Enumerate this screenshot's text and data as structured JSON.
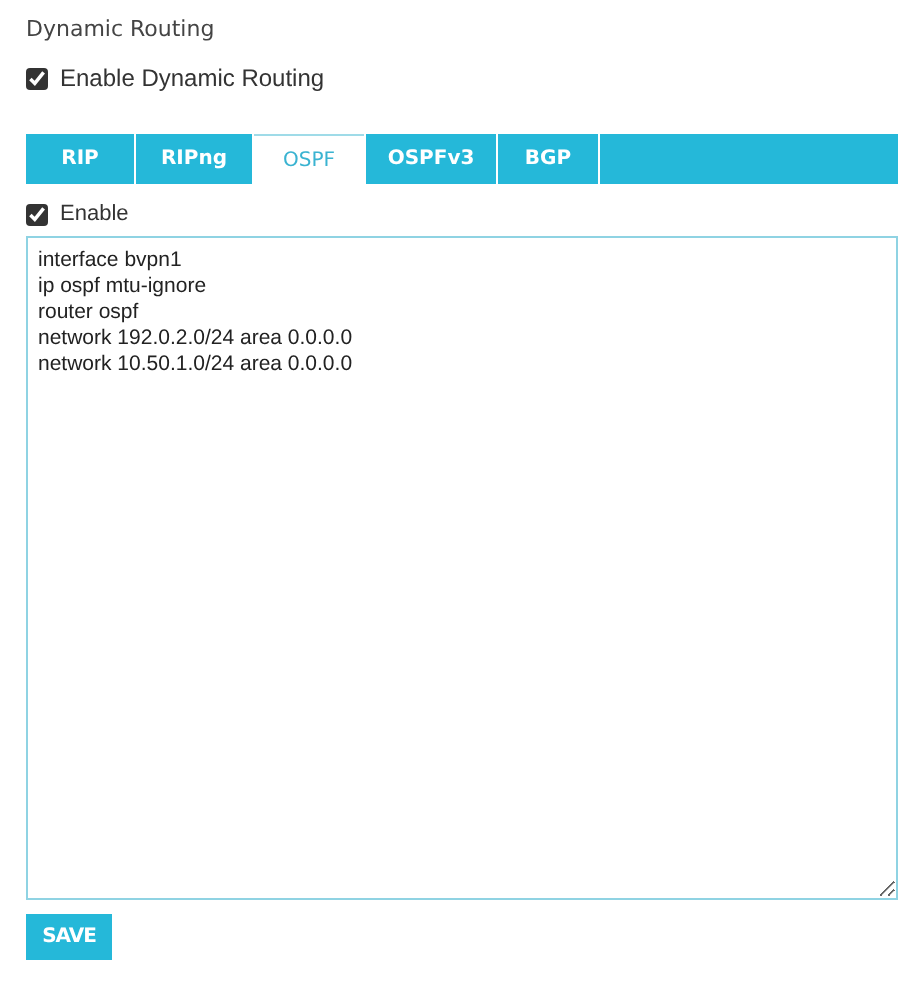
{
  "section_title": "Dynamic Routing",
  "enable_dynamic_routing": {
    "label": "Enable Dynamic Routing",
    "checked": true
  },
  "tabs": [
    {
      "label": "RIP",
      "selected": false
    },
    {
      "label": "RIPng",
      "selected": false
    },
    {
      "label": "OSPF",
      "selected": true
    },
    {
      "label": "OSPFv3",
      "selected": false
    },
    {
      "label": "BGP",
      "selected": false
    }
  ],
  "enable": {
    "label": "Enable",
    "checked": true
  },
  "config": {
    "value": [
      "interface bvpn1",
      "ip ospf mtu-ignore",
      "router ospf",
      "network 192.0.2.0/24 area 0.0.0.0",
      "network 10.50.1.0/24 area 0.0.0.0"
    ]
  },
  "save_button": "SAVE"
}
